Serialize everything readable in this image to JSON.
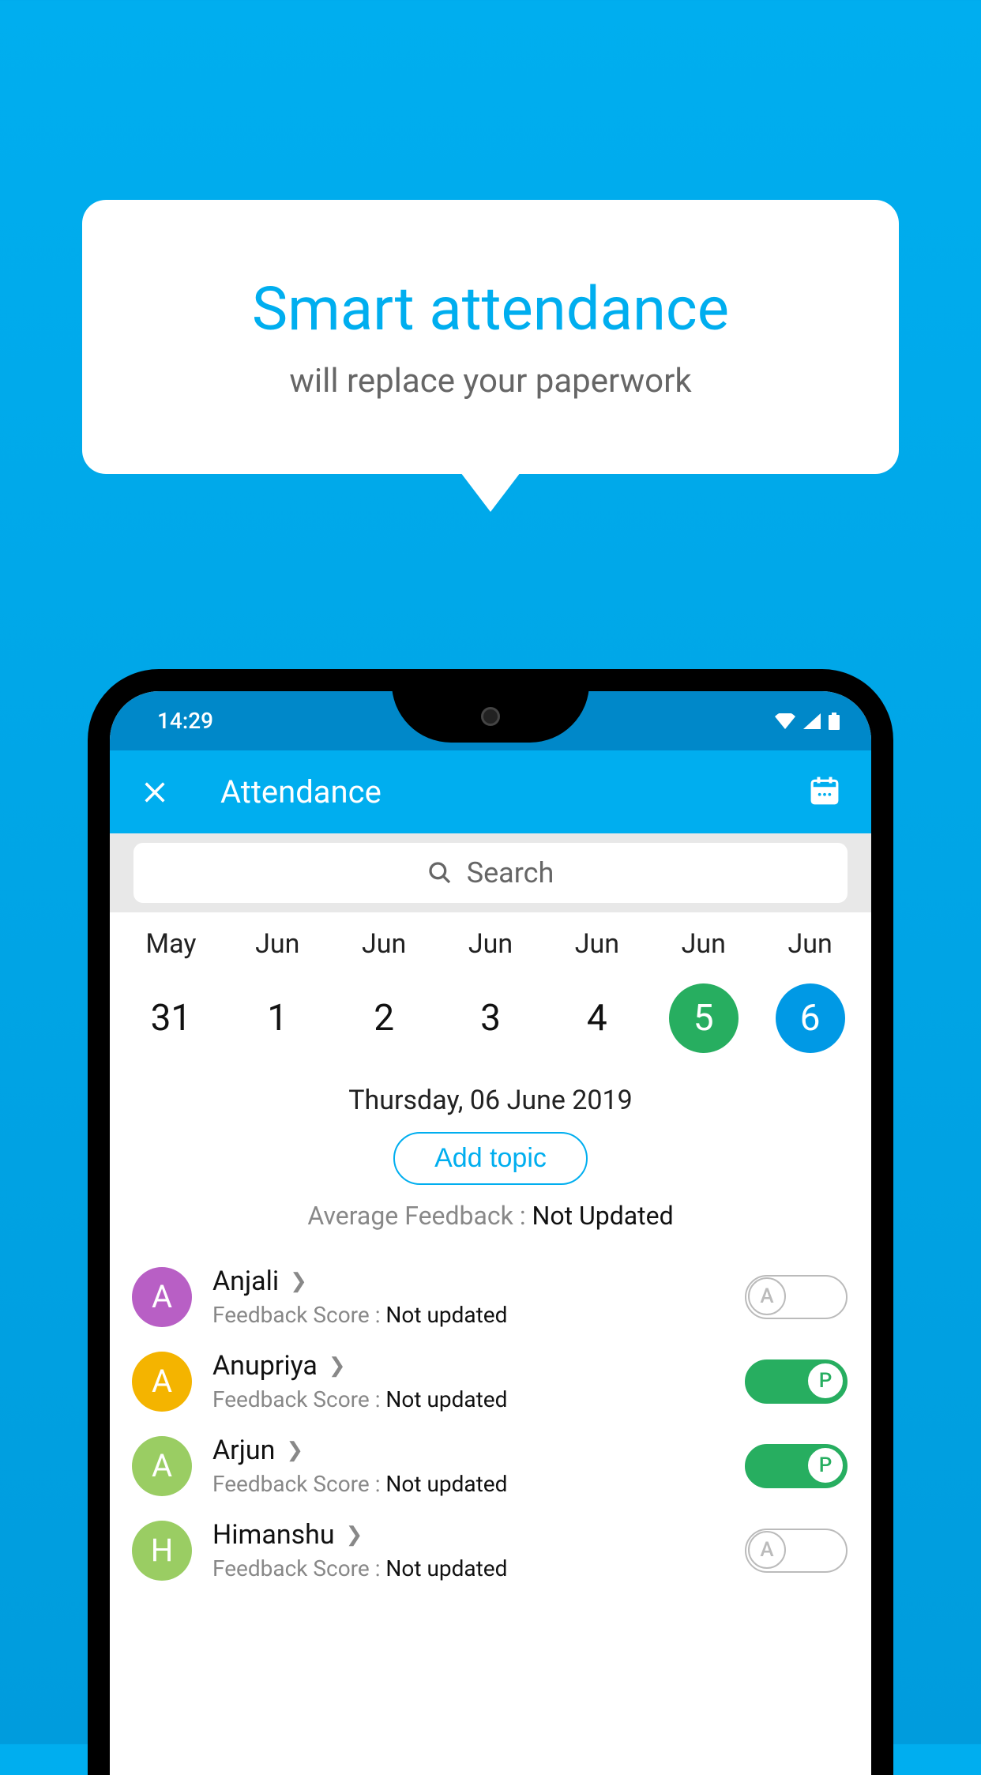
{
  "promo": {
    "title": "Smart attendance",
    "subtitle": "will replace your paperwork"
  },
  "status": {
    "time": "14:29"
  },
  "header": {
    "title": "Attendance"
  },
  "search": {
    "placeholder": "Search"
  },
  "dateStrip": [
    {
      "month": "May",
      "day": "31",
      "state": ""
    },
    {
      "month": "Jun",
      "day": "1",
      "state": ""
    },
    {
      "month": "Jun",
      "day": "2",
      "state": ""
    },
    {
      "month": "Jun",
      "day": "3",
      "state": ""
    },
    {
      "month": "Jun",
      "day": "4",
      "state": ""
    },
    {
      "month": "Jun",
      "day": "5",
      "state": "green"
    },
    {
      "month": "Jun",
      "day": "6",
      "state": "blue"
    }
  ],
  "currentDate": "Thursday, 06 June 2019",
  "addTopic": "Add topic",
  "avgFeedback": {
    "label": "Average Feedback : ",
    "value": "Not Updated"
  },
  "students": [
    {
      "initial": "A",
      "name": "Anjali",
      "feedbackLabel": "Feedback Score : ",
      "feedbackValue": "Not updated",
      "avatarColor": "#b85fc5",
      "status": "absent",
      "statusLetter": "A"
    },
    {
      "initial": "A",
      "name": "Anupriya",
      "feedbackLabel": "Feedback Score : ",
      "feedbackValue": "Not updated",
      "avatarColor": "#f4b400",
      "status": "present",
      "statusLetter": "P"
    },
    {
      "initial": "A",
      "name": "Arjun",
      "feedbackLabel": "Feedback Score : ",
      "feedbackValue": "Not updated",
      "avatarColor": "#9acd63",
      "status": "present",
      "statusLetter": "P"
    },
    {
      "initial": "H",
      "name": "Himanshu",
      "feedbackLabel": "Feedback Score : ",
      "feedbackValue": "Not updated",
      "avatarColor": "#9acd63",
      "status": "absent",
      "statusLetter": "A"
    }
  ]
}
